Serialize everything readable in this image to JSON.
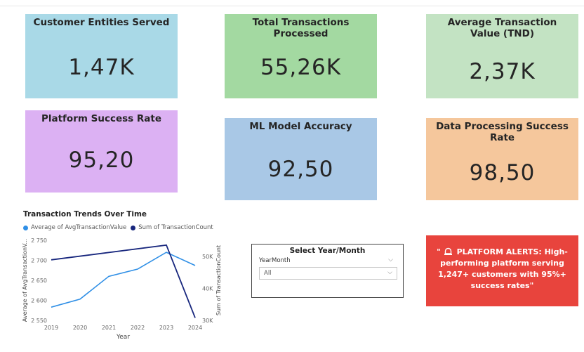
{
  "cards": [
    {
      "title": "Customer Entities Served",
      "value": "1,47K",
      "color": "#a9d9e7"
    },
    {
      "title": "Total Transactions Processed",
      "value": "55,26K",
      "color": "#a3d9a1"
    },
    {
      "title": "Average Transaction Value (TND)",
      "value": "2,37K",
      "color": "#c3e3c3"
    },
    {
      "title": "Platform Success Rate",
      "value": "95,20",
      "color": "#dcb1f3"
    },
    {
      "title": "ML Model Accuracy",
      "value": "92,50",
      "color": "#a9c8e6"
    },
    {
      "title": "Data Processing Success Rate",
      "value": "98,50",
      "color": "#f5c79c"
    }
  ],
  "chart": {
    "title": "Transaction Trends Over Time",
    "legend": [
      {
        "label": "Average of AvgTransactionValue",
        "color": "#2f8fe6"
      },
      {
        "label": "Sum of TransactionCount",
        "color": "#17267d"
      }
    ],
    "y_left_label": "Average of AvgTransactionV...",
    "y_right_label": "Sum of TransactionCount",
    "x_label": "Year"
  },
  "chart_data": {
    "type": "line",
    "x": [
      2019,
      2020,
      2021,
      2022,
      2023,
      2024
    ],
    "series": [
      {
        "name": "Average of AvgTransactionValue",
        "axis": "left",
        "values": [
          2583,
          2603,
          2660,
          2678,
          2720,
          2687
        ]
      },
      {
        "name": "Sum of TransactionCount",
        "axis": "right",
        "values": [
          48900,
          null,
          null,
          null,
          53500,
          30800
        ]
      }
    ],
    "y_left_ticks": [
      "2 550",
      "2 600",
      "2 650",
      "2 700",
      "2 750"
    ],
    "y_left_range": [
      2550,
      2750
    ],
    "y_right_ticks": [
      "30K",
      "40K",
      "50K"
    ],
    "y_right_range": [
      30000,
      55000
    ],
    "x_tick_labels": [
      "2019",
      "2020",
      "2021",
      "2022",
      "2023",
      "2024"
    ],
    "grid": false,
    "legend_position": "top-left"
  },
  "slicer": {
    "title": "Select Year/Month",
    "field": "YearMonth",
    "selected": "All"
  },
  "alert": {
    "text": "\" PLATFORM ALERTS: High-performing platform serving 1,247+ customers with 95%+ success rates\"",
    "prefix": "\"",
    "body": "PLATFORM ALERTS: High-performing platform serving 1,247+ customers with 95%+ success rates\"",
    "icon": "alarm-bell-icon",
    "color": "#e8443d"
  }
}
